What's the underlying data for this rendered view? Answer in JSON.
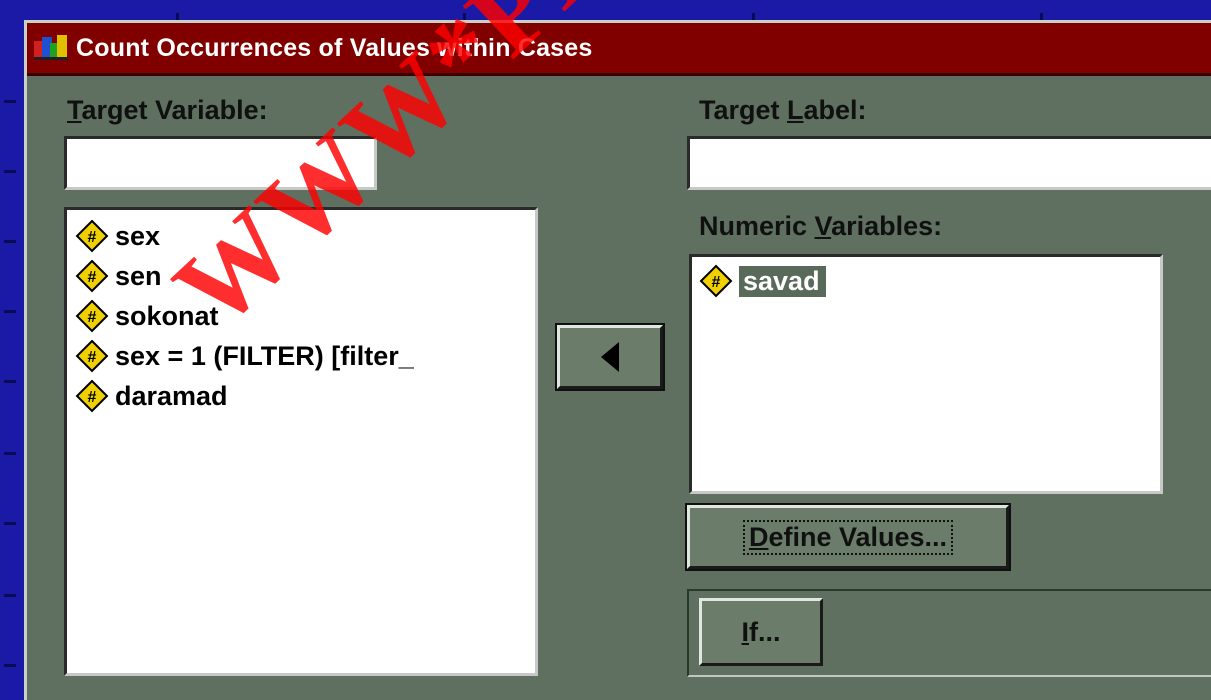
{
  "window": {
    "title": "Count Occurrences of Values within Cases"
  },
  "target_variable": {
    "label_mnemonic": "T",
    "label_rest": "arget Variable:",
    "value": ""
  },
  "target_label": {
    "label_before": "Target ",
    "label_mnemonic": "L",
    "label_after": "abel:",
    "value": ""
  },
  "source_list": {
    "items": [
      {
        "label": "sex",
        "icon": "numeric-variable-icon"
      },
      {
        "label": "sen",
        "icon": "numeric-variable-icon"
      },
      {
        "label": "sokonat",
        "icon": "numeric-variable-icon"
      },
      {
        "label": "sex = 1 (FILTER) [filter_",
        "icon": "numeric-variable-icon"
      },
      {
        "label": "daramad",
        "icon": "numeric-variable-icon"
      }
    ]
  },
  "move_button": {
    "glyph": "◀",
    "icon": "left-arrow-icon"
  },
  "numeric_variables": {
    "label_before": "Numeric ",
    "label_mnemonic": "V",
    "label_after": "ariables:",
    "items": [
      {
        "label": "savad",
        "icon": "numeric-variable-icon",
        "selected": true
      }
    ]
  },
  "define_values_button": {
    "mnemonic": "D",
    "rest": "efine Values..."
  },
  "if_button": {
    "mnemonic": "I",
    "rest": "f..."
  },
  "watermark": {
    "text": "WWW*PNUFB*C"
  },
  "colors": {
    "desktop": "#1a1aa6",
    "dialog_face": "#5f7060",
    "title_bar": "#800000",
    "watermark": "#ff0000",
    "variable_icon": "#f0d000"
  }
}
